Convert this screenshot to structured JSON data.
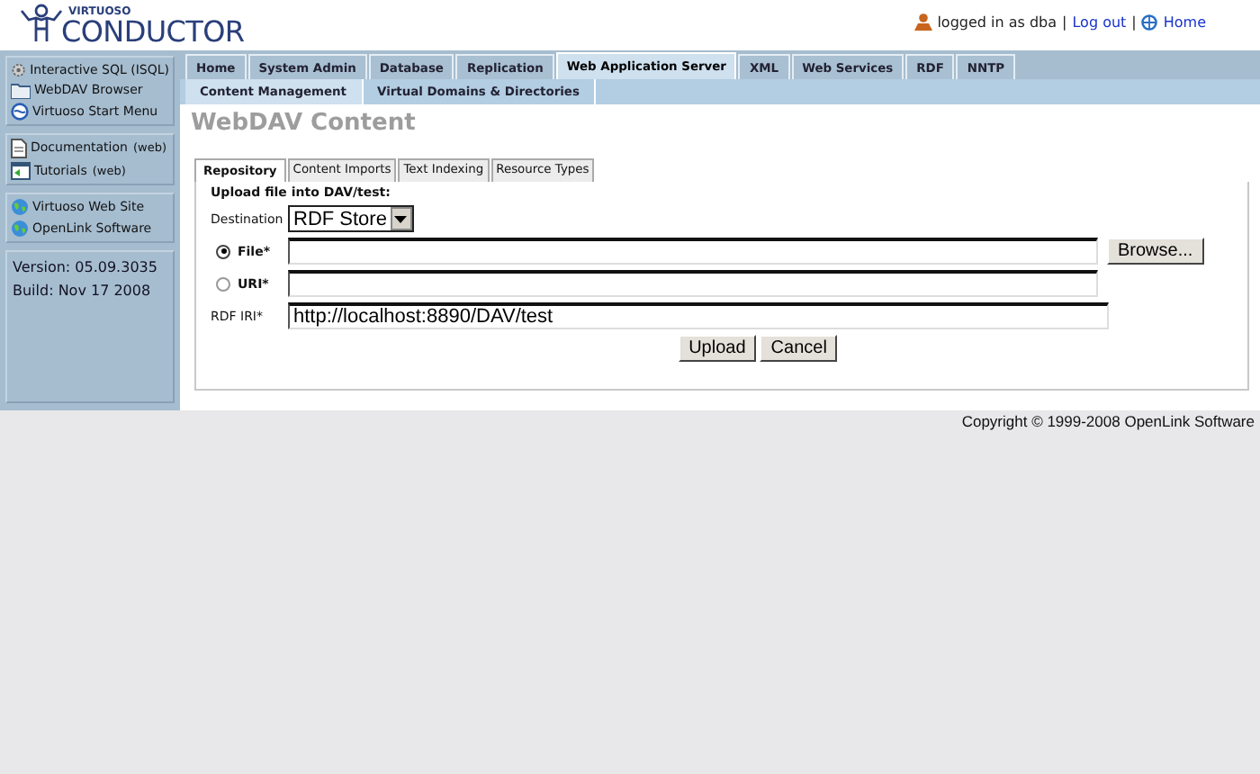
{
  "logo": {
    "small": "VIRTUOSO",
    "big": "CONDUCTOR"
  },
  "user_bar": {
    "status": "logged in as dba",
    "separator_1": "|",
    "logout": "Log out",
    "separator_2": "|",
    "home": "Home"
  },
  "sidebar": {
    "groups": [
      {
        "items": [
          {
            "label": "Interactive SQL (ISQL)",
            "kind": "gear"
          },
          {
            "label": "WebDAV Browser",
            "kind": "folder"
          },
          {
            "label": "Virtuoso Start Menu",
            "kind": "globe"
          }
        ]
      },
      {
        "items": [
          {
            "label": "Documentation",
            "suffix": "(web)",
            "kind": "doc"
          },
          {
            "label": "Tutorials",
            "suffix": "(web)",
            "kind": "tutorial"
          }
        ]
      },
      {
        "items": [
          {
            "label": "Virtuoso Web Site",
            "kind": "earth"
          },
          {
            "label": "OpenLink Software",
            "kind": "earth"
          }
        ]
      }
    ],
    "version": "Version: 05.09.3035",
    "build": "Build: Nov 17 2008"
  },
  "tabs": [
    {
      "label": "Home",
      "selected": false
    },
    {
      "label": "System Admin",
      "selected": false
    },
    {
      "label": "Database",
      "selected": false
    },
    {
      "label": "Replication",
      "selected": false
    },
    {
      "label": "Web Application Server",
      "selected": true
    },
    {
      "label": "XML",
      "selected": false
    },
    {
      "label": "Web Services",
      "selected": false
    },
    {
      "label": "RDF",
      "selected": false
    },
    {
      "label": "NNTP",
      "selected": false
    }
  ],
  "subtabs": [
    {
      "label": "Content Management",
      "selected": true
    },
    {
      "label": "Virtual Domains & Directories",
      "selected": false
    }
  ],
  "page_title": "WebDAV Content",
  "panel_tabs": [
    {
      "label": "Repository",
      "selected": true
    },
    {
      "label": "Content Imports",
      "selected": false
    },
    {
      "label": "Text Indexing",
      "selected": false
    },
    {
      "label": "Resource Types",
      "selected": false
    }
  ],
  "form": {
    "heading": "Upload file into DAV/test:",
    "destination": {
      "label": "Destination",
      "value": "RDF Store"
    },
    "sources": [
      {
        "label": "File*",
        "selected": true,
        "browse": "Browse..."
      },
      {
        "label": "URI*",
        "selected": false
      }
    ],
    "rdf_iri": {
      "label": "RDF IRI*",
      "value": "http://localhost:8890/DAV/test"
    },
    "buttons": [
      "Upload",
      "Cancel"
    ]
  },
  "footer": "Copyright © 1999-2008 OpenLink Software"
}
